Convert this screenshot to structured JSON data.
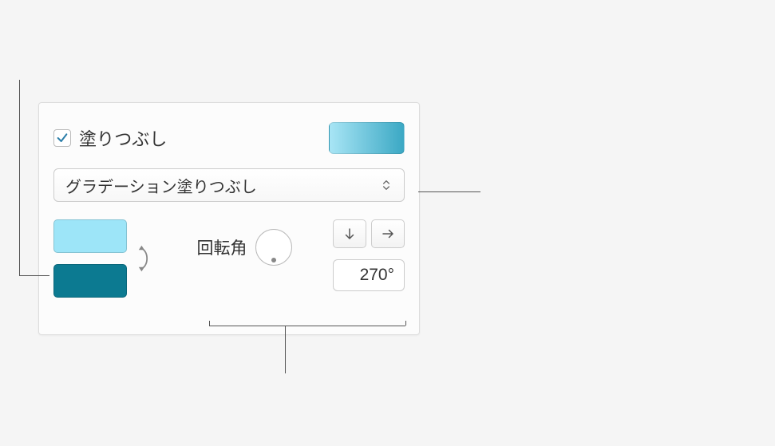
{
  "fill": {
    "checkbox_label": "塗りつぶし",
    "checked": true,
    "dropdown_value": "グラデーション塗りつぶし",
    "gradient": {
      "start_color": "#9de5f8",
      "end_color": "#0c7a91"
    },
    "angle_label": "回転角",
    "angle_value": "270°"
  }
}
